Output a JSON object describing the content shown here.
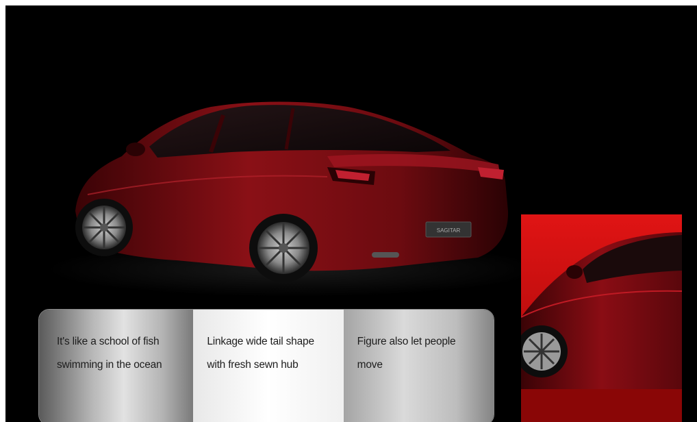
{
  "features": [
    {
      "text": "It's like a school of fish swimming in the ocean"
    },
    {
      "text": "Linkage wide tail shape with fresh sewn hub"
    },
    {
      "text": "Figure also let people move"
    }
  ],
  "colors": {
    "background": "#000000",
    "car_body": "#7a0a10",
    "thumb_background": "#d40f0f"
  },
  "badge_text": "SAGITAR"
}
